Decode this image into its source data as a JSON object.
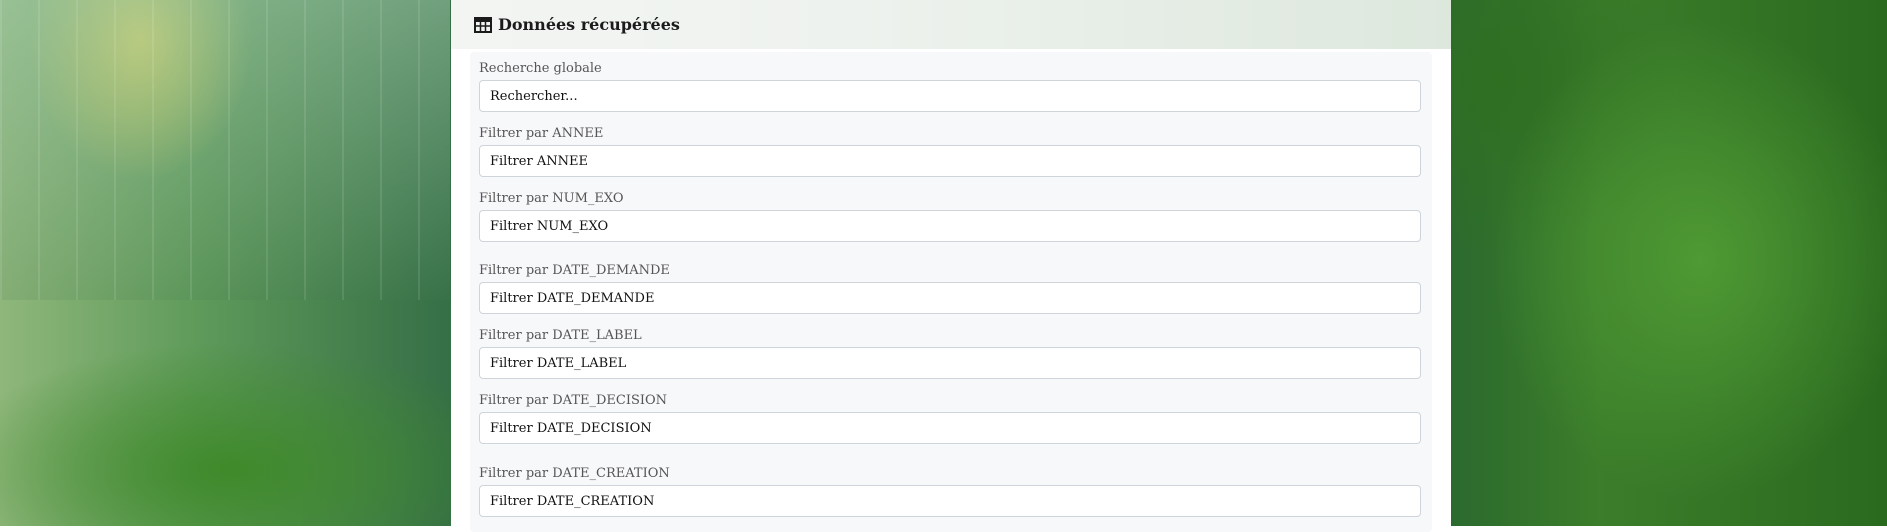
{
  "header": {
    "title": "Données récupérées",
    "icon": "table-icon"
  },
  "fields": [
    {
      "label": "Recherche globale",
      "placeholder": "Rechercher..."
    },
    {
      "label": "Filtrer par ANNEE",
      "placeholder": "Filtrer ANNEE"
    },
    {
      "label": "Filtrer par NUM_EXO",
      "placeholder": "Filtrer NUM_EXO"
    },
    {
      "label": "Filtrer par DATE_DEMANDE",
      "placeholder": "Filtrer DATE_DEMANDE"
    },
    {
      "label": "Filtrer par DATE_LABEL",
      "placeholder": "Filtrer DATE_LABEL"
    },
    {
      "label": "Filtrer par DATE_DECISION",
      "placeholder": "Filtrer DATE_DECISION"
    },
    {
      "label": "Filtrer par DATE_CREATION",
      "placeholder": "Filtrer DATE_CREATION"
    }
  ],
  "colors": {
    "panel_background": "#ffffff",
    "form_background": "#f7f8fa",
    "input_border": "#cfd4da",
    "label_text": "#555555"
  }
}
